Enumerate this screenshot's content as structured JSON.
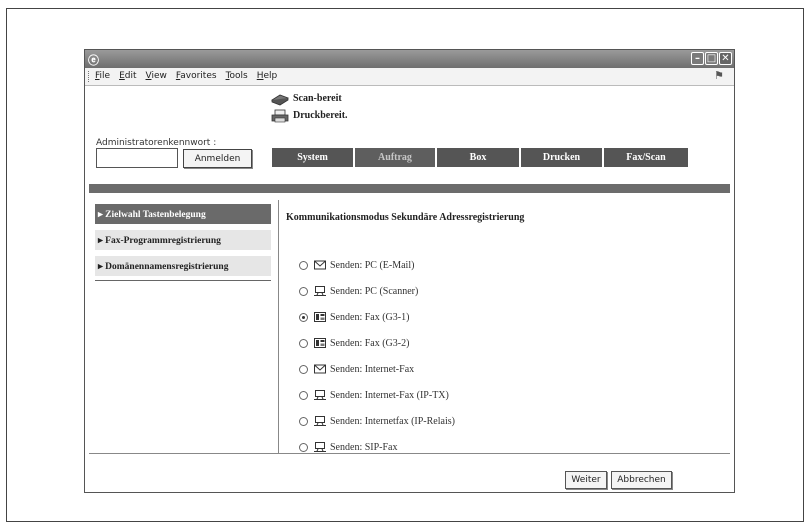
{
  "menubar": {
    "items": [
      "File",
      "Edit",
      "View",
      "Favorites",
      "Tools",
      "Help"
    ]
  },
  "status": {
    "scan": "Scan-bereit",
    "print": "Druckbereit."
  },
  "admin": {
    "label": "Administratorenkennwort :",
    "password_value": "",
    "login_button": "Anmelden"
  },
  "tabs": [
    {
      "label": "System",
      "state": "active"
    },
    {
      "label": "Auftrag",
      "state": "inactive"
    },
    {
      "label": "Box",
      "state": "active"
    },
    {
      "label": "Drucken",
      "state": "active"
    },
    {
      "label": "Fax/Scan",
      "state": "active"
    }
  ],
  "sidebar": {
    "items": [
      {
        "label": "▸ Zielwahl Tastenbelegung",
        "selected": true
      },
      {
        "label": "▸ Fax-Programmregistrierung",
        "selected": false
      },
      {
        "label": "▸ Domänennamensregistrierung",
        "selected": false
      }
    ]
  },
  "main": {
    "title": "Kommunikationsmodus Sekundäre Adressregistrierung",
    "options": [
      {
        "icon": "email-icon",
        "label": "Senden: PC (E-Mail)",
        "checked": false
      },
      {
        "icon": "pc-icon",
        "label": "Senden: PC (Scanner)",
        "checked": false
      },
      {
        "icon": "fax-icon",
        "label": "Senden: Fax (G3-1)",
        "checked": true
      },
      {
        "icon": "fax-icon",
        "label": "Senden: Fax (G3-2)",
        "checked": false
      },
      {
        "icon": "email-icon",
        "label": "Senden: Internet-Fax",
        "checked": false
      },
      {
        "icon": "pc-icon",
        "label": "Senden: Internet-Fax (IP-TX)",
        "checked": false
      },
      {
        "icon": "pc-icon",
        "label": "Senden: Internetfax (IP-Relais)",
        "checked": false
      },
      {
        "icon": "pc-icon",
        "label": "Senden: SIP-Fax",
        "checked": false
      }
    ]
  },
  "footer": {
    "next_button": "Weiter",
    "cancel_button": "Abbrechen"
  },
  "colors": {
    "tab_bg": "#555555",
    "sidebar_active": "#6a6a6a",
    "separator": "#6c6c6c"
  }
}
